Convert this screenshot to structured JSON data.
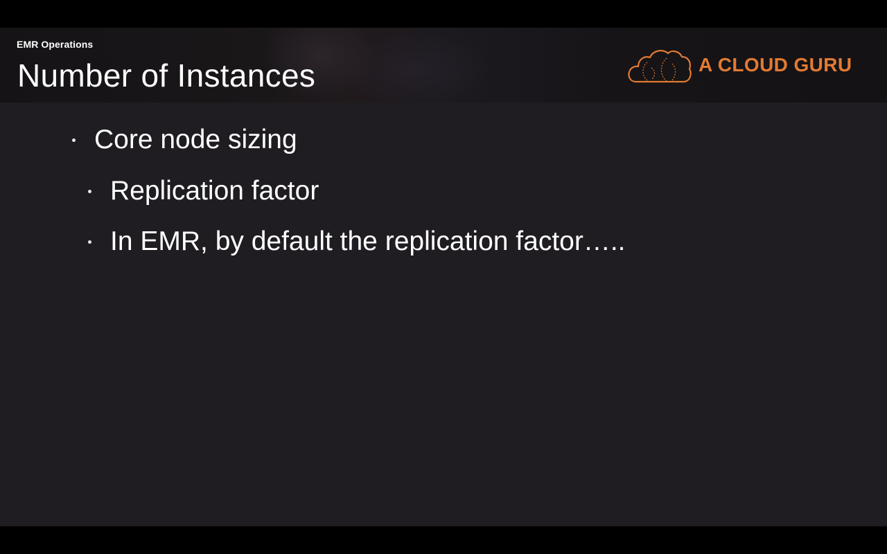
{
  "slide": {
    "section_label": "EMR Operations",
    "title": "Number of Instances",
    "brand": {
      "name": "A CLOUD GURU",
      "logo_icon": "cloud-icon",
      "color": "#e27a33"
    },
    "bullets": [
      {
        "level": 1,
        "text": "Core node sizing"
      },
      {
        "level": 2,
        "text": "Replication factor"
      },
      {
        "level": 2,
        "text": "In EMR, by default the replication factor….."
      }
    ]
  },
  "colors": {
    "background": "#1f1d21",
    "letterbox": "#000000",
    "text": "#ffffff",
    "accent": "#e27a33"
  }
}
